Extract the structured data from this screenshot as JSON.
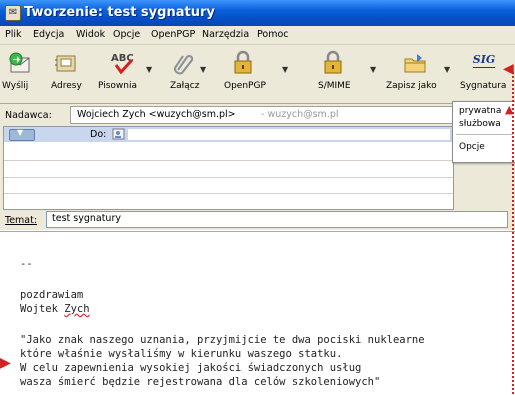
{
  "window": {
    "title": "Tworzenie: test sygnatury"
  },
  "menu": [
    "Plik",
    "Edycja",
    "Widok",
    "Opcje",
    "OpenPGP",
    "Narzędzia",
    "Pomoc"
  ],
  "toolbar": {
    "buttons": [
      {
        "label": "Wyślij",
        "icon": "send-icon"
      },
      {
        "label": "Adresy",
        "icon": "address-book-icon"
      },
      {
        "label": "Pisownia",
        "icon": "spellcheck-icon"
      },
      {
        "label": "Załącz",
        "icon": "paperclip-icon"
      },
      {
        "label": "OpenPGP",
        "icon": "padlock-icon"
      },
      {
        "label": "S/MIME",
        "icon": "padlock-icon"
      },
      {
        "label": "Zapisz jako",
        "icon": "folder-icon"
      },
      {
        "label": "Sygnatura",
        "icon": "signature-icon"
      }
    ],
    "signature_icon_text": "SIG"
  },
  "headers": {
    "from_label": "Nadawca:",
    "from_value": "Wojciech Zych <wuzych@sm.pl>",
    "from_extra": "- wuzych@sm.pl",
    "to_label": "Do:",
    "subject_label": "Temat:",
    "subject_value": "test sygnatury"
  },
  "popup": {
    "items": [
      "prywatna",
      "służbowa",
      "Opcje"
    ]
  },
  "body": {
    "lines": [
      "--",
      "",
      "pozdrawiam",
      "Wojtek Zych",
      "",
      "\"Jako znak naszego uznania, przyjmijcie te dwa pociski nuklearne",
      "które właśnie wysłaliśmy w kierunku waszego statku.",
      "W celu zapewnienia wysokiej jakości świadczonych usług",
      "wasza śmierć będzie rejestrowana dla celów szkoleniowych\""
    ]
  },
  "colors": {
    "titlebar": "#0a5fd8",
    "chrome": "#ece9d8",
    "annotation": "#d42020"
  }
}
